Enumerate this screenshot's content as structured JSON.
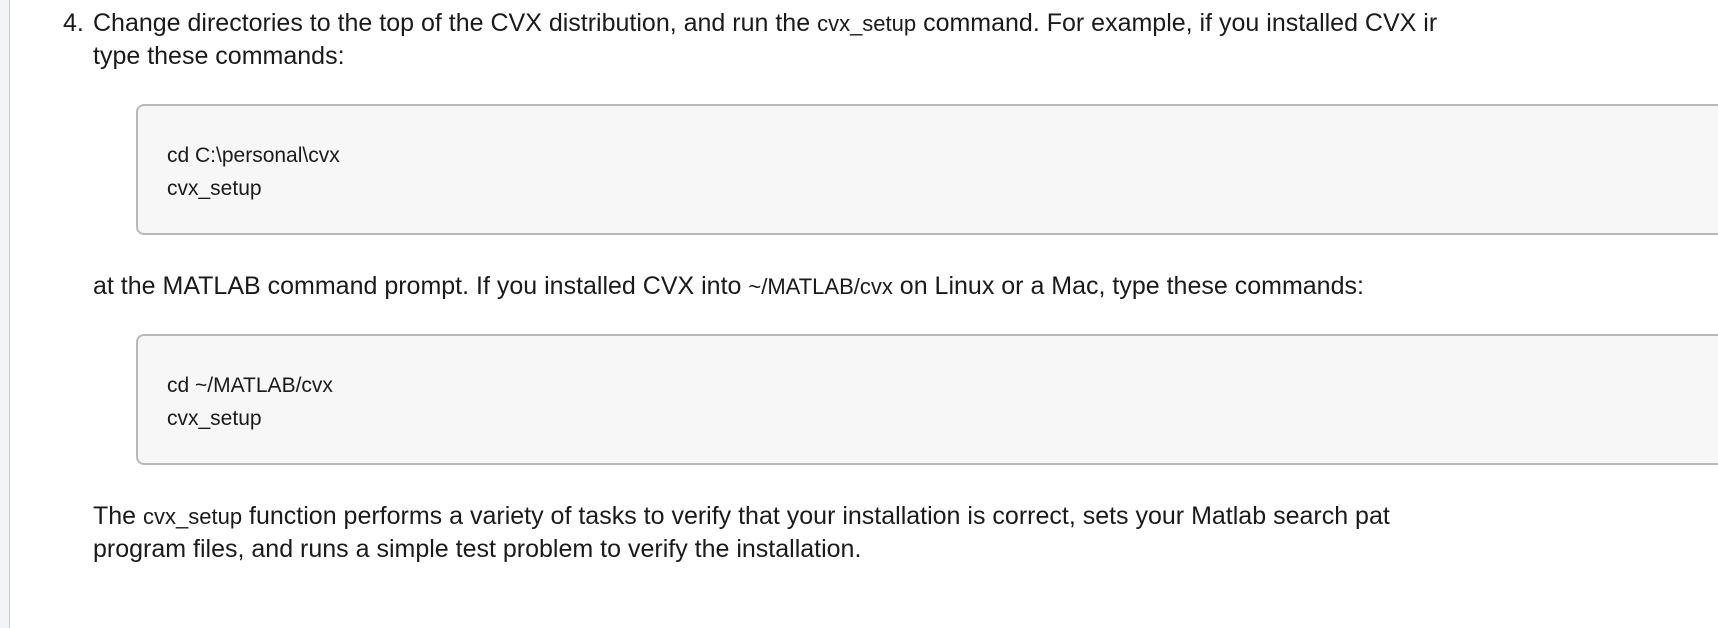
{
  "step": {
    "number": "4.",
    "intro_line1_a": "Change directories to the top of the CVX distribution, and run the ",
    "intro_line1_code": "cvx_setup",
    "intro_line1_b": " command. For example, if you installed CVX ir",
    "intro_line2": "type these commands:"
  },
  "code_block_windows": {
    "line1": "cd C:\\personal\\cvx",
    "line2": "cvx_setup"
  },
  "middle": {
    "text_a": "at the MATLAB command prompt. If you installed CVX into ",
    "code": "~/MATLAB/cvx",
    "text_b": " on Linux or a Mac, type these commands:"
  },
  "code_block_unix": {
    "line1": "cd ~/MATLAB/cvx",
    "line2": "cvx_setup"
  },
  "closing": {
    "text_a": "The ",
    "code": "cvx_setup",
    "text_b": " function performs a variety of tasks to verify that your installation is correct, sets your Matlab search pat",
    "line2": "program files, and runs a simple test problem to verify the installation."
  }
}
